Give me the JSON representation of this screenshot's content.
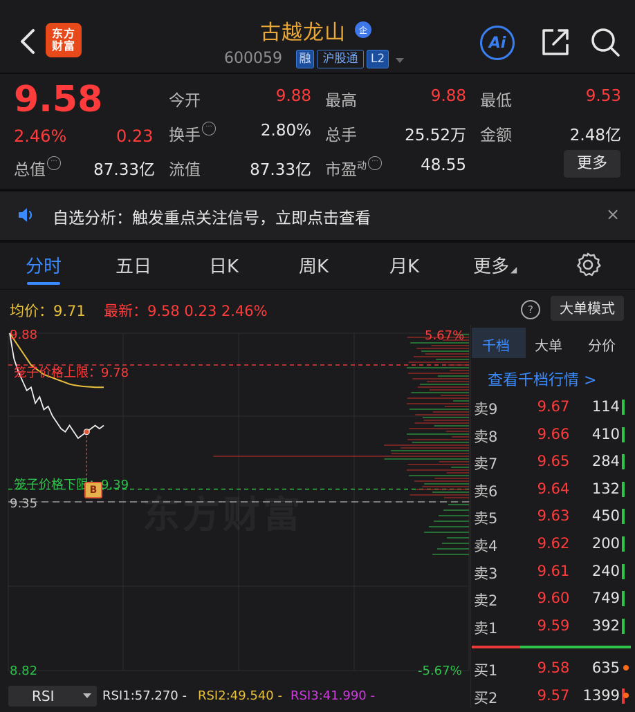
{
  "header": {
    "stock_name": "古越龙山",
    "name_badge": "企",
    "stock_code": "600059",
    "tags": [
      "融",
      "沪股通",
      "L2"
    ],
    "logo_line1": "东方",
    "logo_line2": "财富",
    "ai_label": "Ai"
  },
  "quote": {
    "price": "9.58",
    "change_pct": "2.46%",
    "change": "0.23",
    "fields": [
      {
        "label": "今开",
        "value": "9.88"
      },
      {
        "label": "最高",
        "value": "9.88"
      },
      {
        "label": "最低",
        "value": "9.53"
      },
      {
        "label": "换手",
        "value": "2.80%"
      },
      {
        "label": "总手",
        "value": "25.52万"
      },
      {
        "label": "金额",
        "value": "2.48亿"
      },
      {
        "label": "总值",
        "value": "87.33亿"
      },
      {
        "label": "流值",
        "value": "87.33亿"
      },
      {
        "label": "市盈",
        "value": "48.55"
      }
    ],
    "pe_superscript": "动",
    "more_label": "更多"
  },
  "notice": {
    "text": "自选分析：触发重点关注信号，立即点击查看",
    "close": "×"
  },
  "tabs": [
    "分时",
    "五日",
    "日K",
    "周K",
    "月K",
    "更多"
  ],
  "chart_header": {
    "avg": "均价：9.71",
    "last": "最新：9.58  0.23  2.46%",
    "help": "?",
    "mode_button": "大单模式"
  },
  "chart": {
    "top_price": "9.88",
    "top_pct": "5.67%",
    "bottom_price": "8.82",
    "bottom_pct": "-5.67%",
    "prev_close_label": "9.35",
    "upper_limit_label": "笼子价格上限：9.78",
    "lower_limit_label": "笼子价格下限：9.39",
    "buy_marker": "B",
    "watermark": "东方财富"
  },
  "chart_data": {
    "type": "line",
    "series": [
      {
        "values": [
          9.88,
          9.8,
          9.76,
          9.73,
          9.7,
          9.71,
          9.66,
          9.68,
          9.64,
          9.65,
          9.62,
          9.6,
          9.58,
          9.57,
          9.59,
          9.57,
          9.55,
          9.56,
          9.57,
          9.58,
          9.59,
          9.58,
          9.59
        ]
      },
      {
        "values": [
          9.88,
          9.86,
          9.84,
          9.82,
          9.8,
          9.78,
          9.77,
          9.76,
          9.75,
          9.745,
          9.74,
          9.735,
          9.73,
          9.725,
          9.72,
          9.717,
          9.715,
          9.713,
          9.712,
          9.711,
          9.71,
          9.71,
          9.71
        ]
      }
    ],
    "ylim": [
      8.82,
      9.88
    ],
    "prev_close": 9.35,
    "upper_limit": 9.78,
    "lower_limit": 9.39
  },
  "orderbook": {
    "tabs": [
      "千档",
      "大单",
      "分价"
    ],
    "link": "查看千档行情 >",
    "asks": [
      {
        "side": "卖9",
        "price": "9.67",
        "vol": "114"
      },
      {
        "side": "卖8",
        "price": "9.66",
        "vol": "410"
      },
      {
        "side": "卖7",
        "price": "9.65",
        "vol": "284"
      },
      {
        "side": "卖6",
        "price": "9.64",
        "vol": "132"
      },
      {
        "side": "卖5",
        "price": "9.63",
        "vol": "450"
      },
      {
        "side": "卖4",
        "price": "9.62",
        "vol": "200"
      },
      {
        "side": "卖3",
        "price": "9.61",
        "vol": "240"
      },
      {
        "side": "卖2",
        "price": "9.60",
        "vol": "749"
      },
      {
        "side": "卖1",
        "price": "9.59",
        "vol": "392"
      }
    ],
    "bids": [
      {
        "side": "买1",
        "price": "9.58",
        "vol": "635"
      },
      {
        "side": "买2",
        "price": "9.57",
        "vol": "1399"
      }
    ]
  },
  "rsi": {
    "selector": "RSI",
    "rsi1": "RSI1:57.270 -",
    "rsi2": "RSI2:49.540 -",
    "rsi3": "RSI3:41.990 -"
  },
  "colors": {
    "up": "#ff3b3b",
    "down": "#2ec24a",
    "accent": "#3a8bff",
    "brand": "#e8491b",
    "name": "#e8a736"
  }
}
